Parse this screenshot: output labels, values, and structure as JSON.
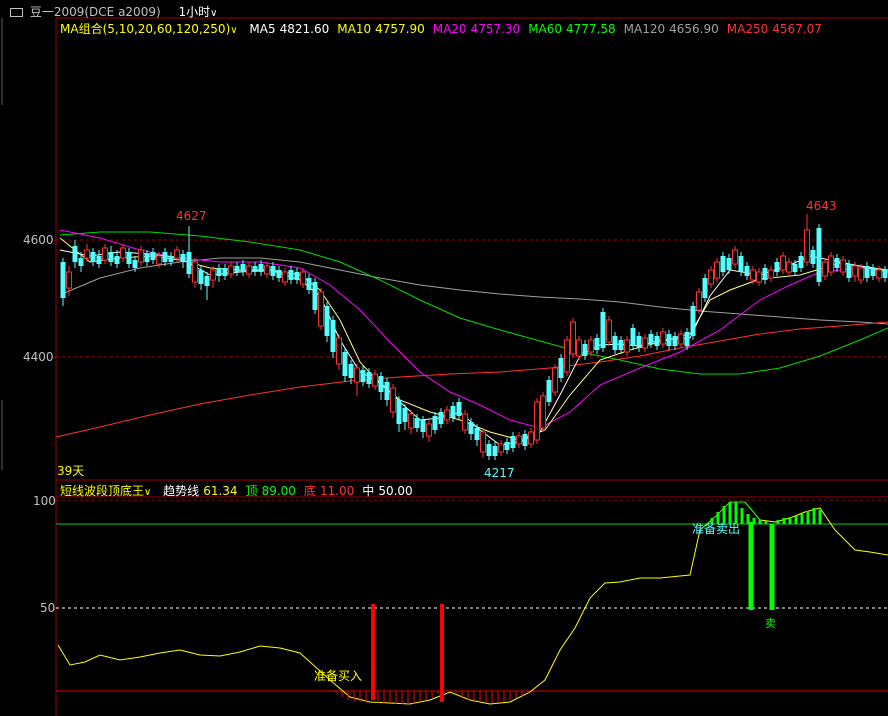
{
  "title": {
    "symbol": "豆一2009(DCE a2009)",
    "period": "1小时"
  },
  "ma_header": {
    "label": "MA组合(5,10,20,60,120,250)",
    "items": [
      {
        "name": "MA5",
        "value": "4821.60",
        "color": "#ffffff"
      },
      {
        "name": "MA10",
        "value": "4757.90",
        "color": "#ffff00"
      },
      {
        "name": "MA20",
        "value": "4757.30",
        "color": "#ff00ff"
      },
      {
        "name": "MA60",
        "value": "4777.58",
        "color": "#00ff00"
      },
      {
        "name": "MA120",
        "value": "4656.90",
        "color": "#a0a0a0"
      },
      {
        "name": "MA250",
        "value": "4567.07",
        "color": "#ff3232"
      }
    ]
  },
  "price_axis": {
    "labels": [
      "4600",
      "4400"
    ],
    "ticks": [
      4600,
      4400
    ]
  },
  "annotations": {
    "high_left": "4627",
    "high_right": "4643",
    "low": "4217",
    "days": "39天"
  },
  "indicator": {
    "name": "短线波段顶底王",
    "items": [
      {
        "label": "趋势线",
        "value": "61.34",
        "color": "#ffff00"
      },
      {
        "label": "顶",
        "value": "89.00",
        "color": "#00ff00"
      },
      {
        "label": "底",
        "value": "11.00",
        "color": "#ff3232"
      },
      {
        "label": "中",
        "value": "50.00",
        "color": "#ffffff"
      }
    ],
    "axis": [
      "100",
      "50"
    ],
    "buy_label": "准备买入",
    "sell_label": "准备卖出",
    "sell_char": "卖"
  },
  "colors": {
    "bg": "#000000",
    "up": "#ff3232",
    "down": "#54ffff",
    "grid_red": "#a00000",
    "axis_label": "#c0c0c0"
  }
}
